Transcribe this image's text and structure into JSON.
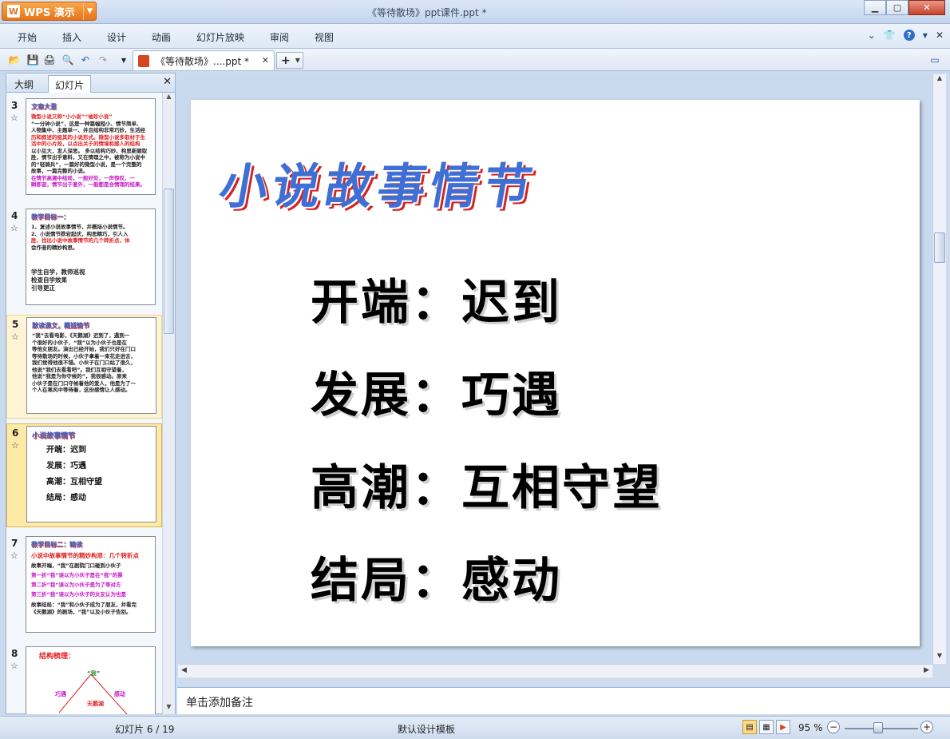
{
  "window": {
    "app_name": "WPS 演示",
    "doc_title": "《等待散场》ppt课件.ppt *"
  },
  "menu": {
    "items": [
      "开始",
      "插入",
      "设计",
      "动画",
      "幻灯片放映",
      "审阅",
      "视图"
    ]
  },
  "toolbar": {
    "tab_label": "《等待散场》....ppt *",
    "new_tab_label": "+"
  },
  "left_panel": {
    "tabs": [
      "大纲",
      "幻灯片"
    ],
    "active_tab": "幻灯片",
    "thumbs": [
      {
        "number": "3",
        "title": "文章大意",
        "lines": [
          {
            "text": "微型小说又称“小小说”“袖珍小说”",
            "style": "red"
          },
          {
            "text": "“一分钟小说”，这是一种篇幅短小、情节简单、",
            "style": ""
          },
          {
            "text": "人物集中、主题单一、并且结构非常巧妙，生活经",
            "style": ""
          },
          {
            "text": "历和叙述的极其的小说形式。微型小说多取材于生",
            "style": "red"
          },
          {
            "text": "活中的小片段，以点出关于的情境和感人的结构",
            "style": "red"
          },
          {
            "text": "以小见大，发人深思。 多以结构巧妙、构思新颖取",
            "style": ""
          },
          {
            "text": "胜，情节出乎意料，又在情理之中，被称为小说中",
            "style": ""
          },
          {
            "text": "的“轻骑兵”，一篇好的微型小说，是一个完整的",
            "style": ""
          },
          {
            "text": "故事，一篇完整的小说。",
            "style": ""
          },
          {
            "text": "在情节高潮中结局，一般好处，一声惊叹，一",
            "style": "mag"
          },
          {
            "text": "瞬即逝，情节出于意外，一般都是合情理的结果。",
            "style": "mag"
          }
        ]
      },
      {
        "number": "4",
        "title": "教学目标一：",
        "lines": [
          {
            "text": "1、复述小说故事情节，并概括小说情节。",
            "style": ""
          },
          {
            "text": "2、小说情节跌宕起伏，构思精巧，引人入",
            "style": ""
          },
          {
            "text": "胜，找出小说中故事情节的几个转折点，体",
            "style": "red"
          },
          {
            "text": "会作者的精妙构思。",
            "style": ""
          }
        ],
        "footer": [
          "学生自学，教师巡视",
          "检查自学效果",
          "引导更正"
        ]
      },
      {
        "number": "5",
        "title": "默读课文，概括情节",
        "lines": [
          {
            "text": "“我”去看电影，《天鹅湖》迟到了，遇到一",
            "style": ""
          },
          {
            "text": "个很好的小伙子，“我”以为小伙子也是在",
            "style": ""
          },
          {
            "text": "等他女朋友。演出已经开始，我们只好在门口",
            "style": ""
          },
          {
            "text": "等待散场的时候，小伙子拿着一束花走进去，",
            "style": ""
          },
          {
            "text": "我们觉得他很不错。小伙子在门口站了很久，",
            "style": ""
          },
          {
            "text": "他说“我们去看看吧”。我们互相守望着，",
            "style": ""
          },
          {
            "text": "他说“我是为你守候的”，我很感动。原来",
            "style": ""
          },
          {
            "text": "小伙子是在门口守候着他的爱人，他是为了一",
            "style": ""
          },
          {
            "text": "个人在寒风中等待着，这份感情让人感动。",
            "style": ""
          }
        ]
      },
      {
        "number": "6",
        "title": "小说故事情节",
        "big_lines": [
          "开端：迟到",
          "发展：巧遇",
          "高潮：互相守望",
          "结局：感动"
        ]
      },
      {
        "number": "7",
        "title": "教学目标二：精读",
        "lines": [
          {
            "text": "小说中故事情节的精妙构思：几个转折点",
            "style": "red"
          },
          {
            "text": "故事开端，“我”在剧院门口碰到小伙子",
            "style": ""
          },
          {
            "text": "第一折“我”误以为小伙子是在“我”的票",
            "style": "mag"
          },
          {
            "text": "第二折“我”误以为小伙子是为了等对方",
            "style": "mag"
          },
          {
            "text": "第三折“我”误以为小伙子的女友认为也是",
            "style": "mag"
          },
          {
            "text": "故事结局：“我”和小伙子成为了朋友，并看完",
            "style": ""
          },
          {
            "text": "《天鹅湖》的剧场，“我”以及小伙子告别。",
            "style": ""
          }
        ]
      },
      {
        "number": "8",
        "title": "结构梳理：",
        "labels": [
          "“我”",
          "巧遇",
          "感动",
          "天鹅湖"
        ]
      }
    ]
  },
  "slide": {
    "title": "小说故事情节",
    "lines": [
      "开端：迟到",
      "发展：巧遇",
      "高潮：互相守望",
      "结局：感动"
    ]
  },
  "notes": {
    "placeholder": "单击添加备注"
  },
  "status": {
    "slide_counter": "幻灯片 6 / 19",
    "template": "默认设计模板",
    "zoom": "95 %"
  },
  "colors": {
    "accent": "#3f6fd4",
    "title_shadow": "#d42222",
    "wps_orange": "#e7731a"
  }
}
